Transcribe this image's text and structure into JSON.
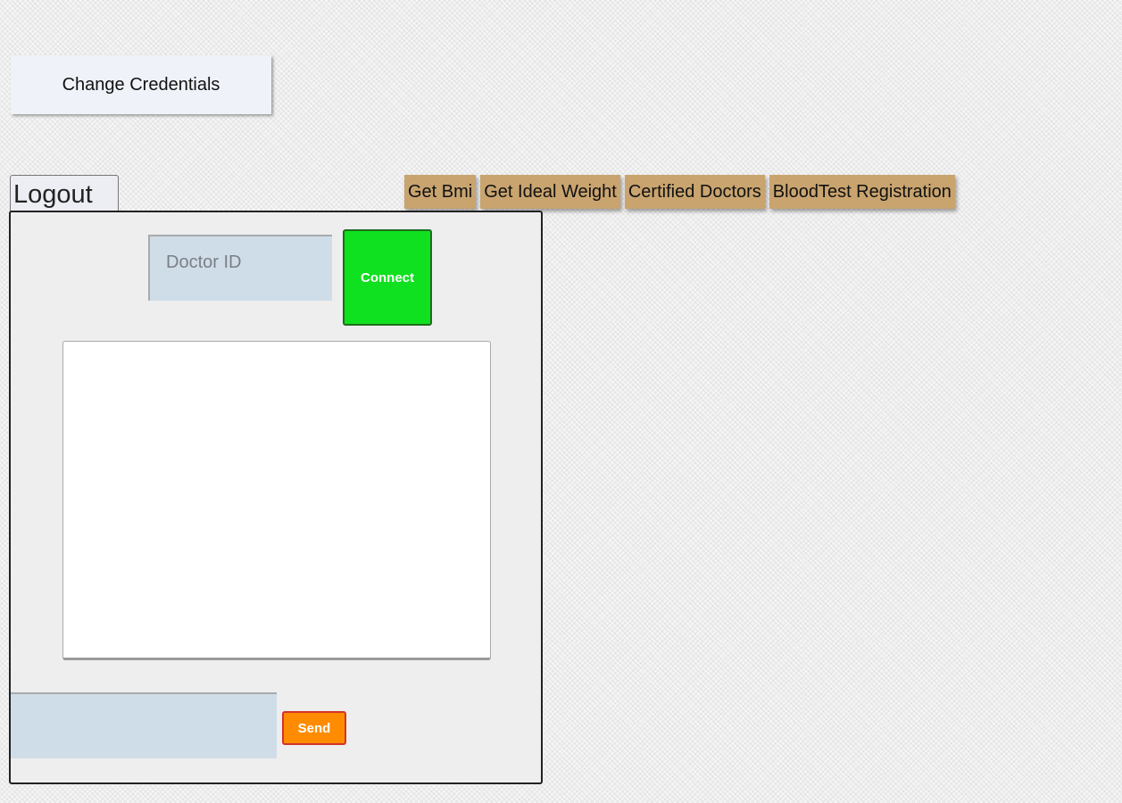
{
  "header": {
    "change_credentials_label": "Change Credentials",
    "logout_label": "Logout"
  },
  "nav": {
    "items": [
      {
        "label": "Get Bmi"
      },
      {
        "label": "Get Ideal Weight"
      },
      {
        "label": "Certified Doctors"
      },
      {
        "label": "BloodTest Registration"
      }
    ]
  },
  "chat": {
    "doctor_id": {
      "placeholder": "Doctor ID",
      "value": ""
    },
    "connect_label": "Connect",
    "messages_text": "",
    "message_input_value": "",
    "send_label": "Send"
  },
  "colors": {
    "nav_button": "#c9a46f",
    "connect_button": "#0fe01f",
    "send_button": "#ff8c00",
    "input_background": "#cfdde8",
    "panel_background": "#eeeeee"
  }
}
